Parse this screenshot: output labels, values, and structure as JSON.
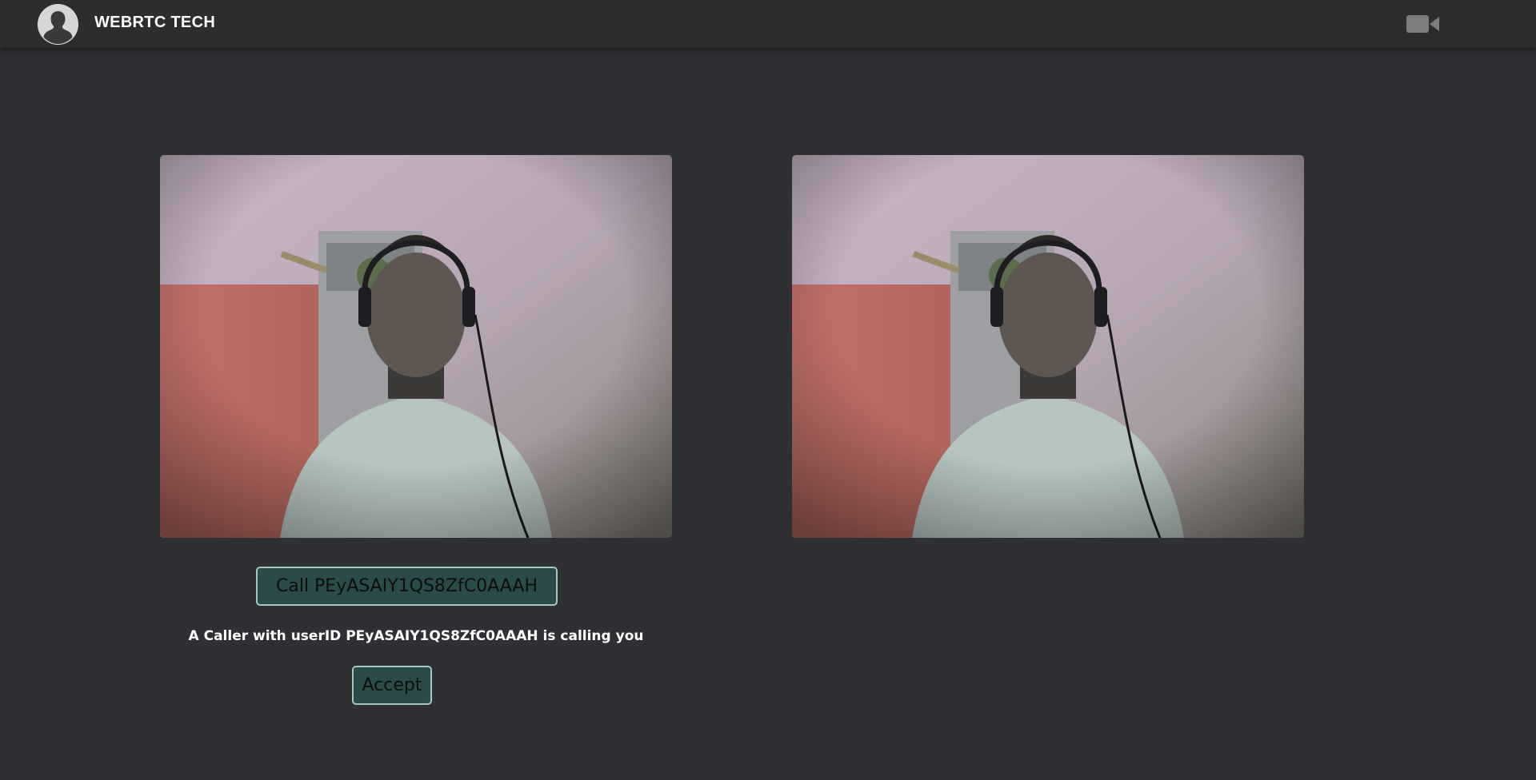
{
  "header": {
    "brand": "WEBRTC TECH",
    "avatar_icon": "user-silhouette-icon",
    "video_icon": "video-camera-icon"
  },
  "videos": {
    "local_label": "local-video",
    "remote_label": "remote-video"
  },
  "actions": {
    "call_label": "Call PEyASAIY1QS8ZfC0AAAH",
    "incoming_text": "A Caller with userID PEyASAIY1QS8ZfC0AAAH is calling you",
    "accept_label": "Accept"
  },
  "colors": {
    "background": "#2f3034",
    "topbar": "#2c2e2d",
    "button_bg": "#2b4a4a",
    "button_border": "#a9c6c6"
  }
}
